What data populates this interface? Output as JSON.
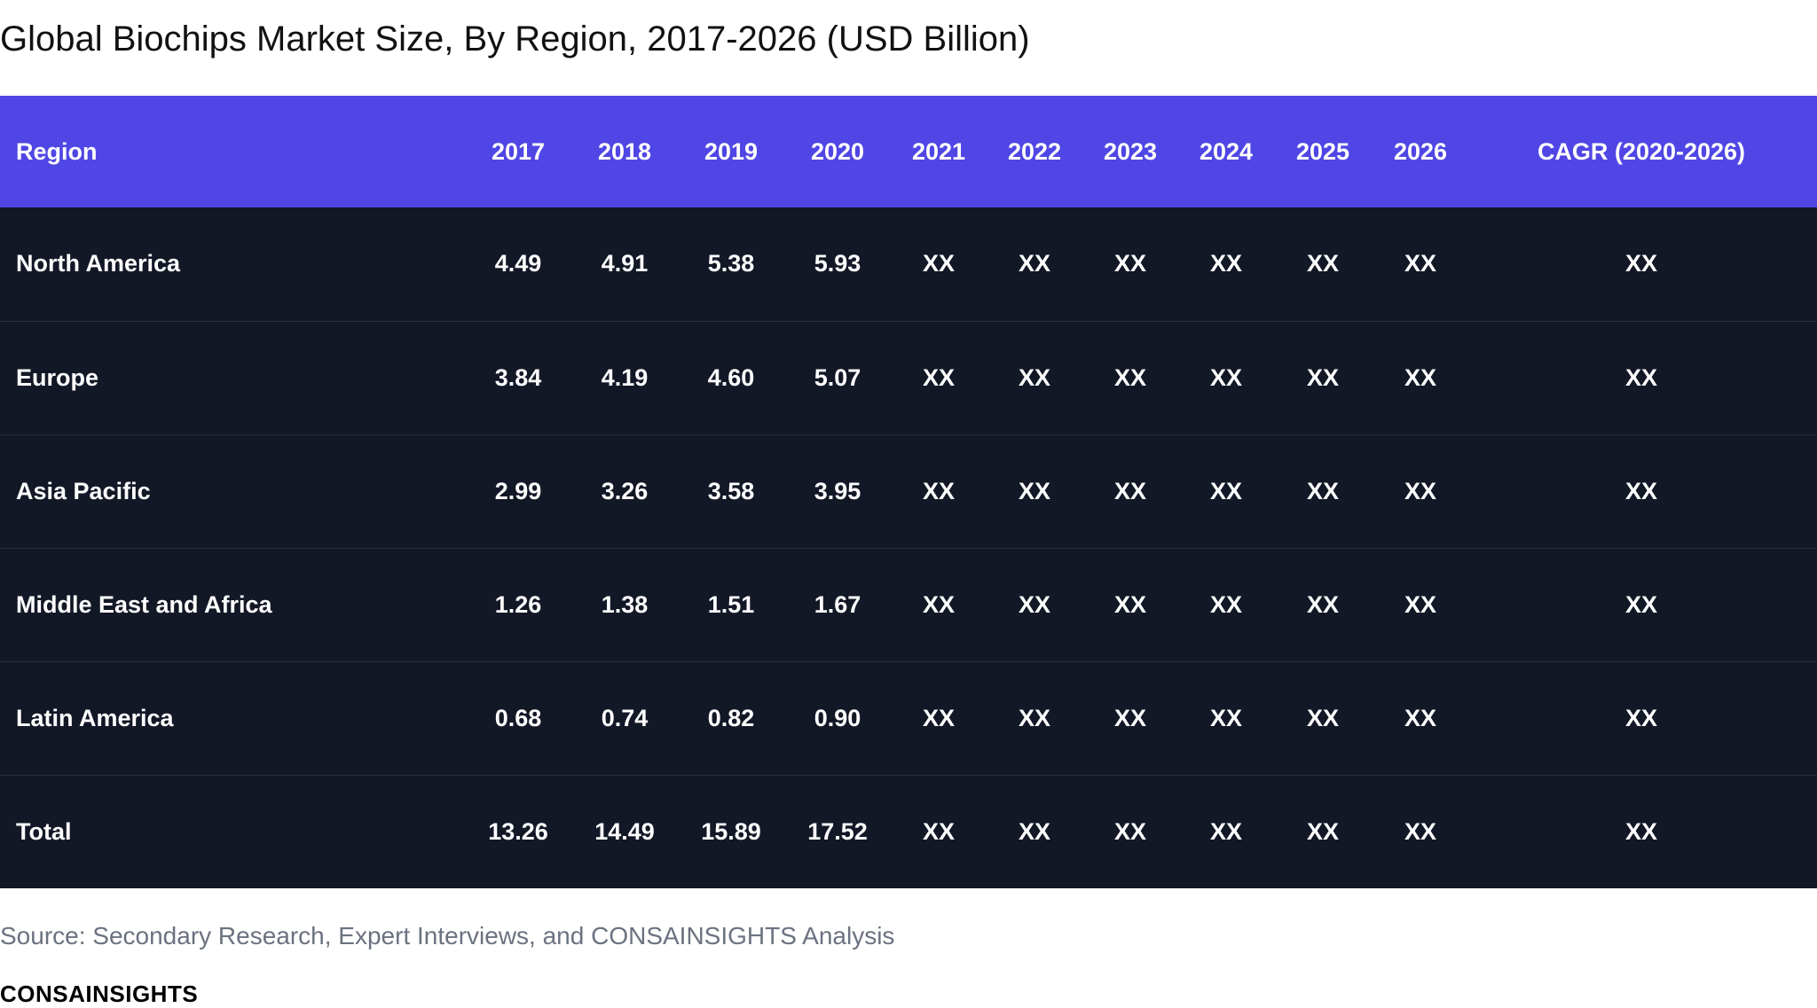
{
  "title": "Global Biochips Market Size, By Region, 2017-2026 (USD Billion)",
  "source": "Source: Secondary Research, Expert Interviews, and CONSAINSIGHTS Analysis",
  "brand": "CONSAINSIGHTS",
  "colors": {
    "header_bg": "#5046e5",
    "row_bg": "#131827",
    "text_on_dark": "#ffffff"
  },
  "chart_data": {
    "type": "table",
    "title": "Global Biochips Market Size, By Region, 2017-2026 (USD Billion)",
    "columns": [
      "Region",
      "2017",
      "2018",
      "2019",
      "2020",
      "2021",
      "2022",
      "2023",
      "2024",
      "2025",
      "2026",
      "CAGR (2020-2026)"
    ],
    "rows": [
      [
        "North America",
        "4.49",
        "4.91",
        "5.38",
        "5.93",
        "XX",
        "XX",
        "XX",
        "XX",
        "XX",
        "XX",
        "XX"
      ],
      [
        "Europe",
        "3.84",
        "4.19",
        "4.60",
        "5.07",
        "XX",
        "XX",
        "XX",
        "XX",
        "XX",
        "XX",
        "XX"
      ],
      [
        "Asia Pacific",
        "2.99",
        "3.26",
        "3.58",
        "3.95",
        "XX",
        "XX",
        "XX",
        "XX",
        "XX",
        "XX",
        "XX"
      ],
      [
        "Middle East and Africa",
        "1.26",
        "1.38",
        "1.51",
        "1.67",
        "XX",
        "XX",
        "XX",
        "XX",
        "XX",
        "XX",
        "XX"
      ],
      [
        "Latin America",
        "0.68",
        "0.74",
        "0.82",
        "0.90",
        "XX",
        "XX",
        "XX",
        "XX",
        "XX",
        "XX",
        "XX"
      ],
      [
        "Total",
        "13.26",
        "14.49",
        "15.89",
        "17.52",
        "XX",
        "XX",
        "XX",
        "XX",
        "XX",
        "XX",
        "XX"
      ]
    ]
  }
}
